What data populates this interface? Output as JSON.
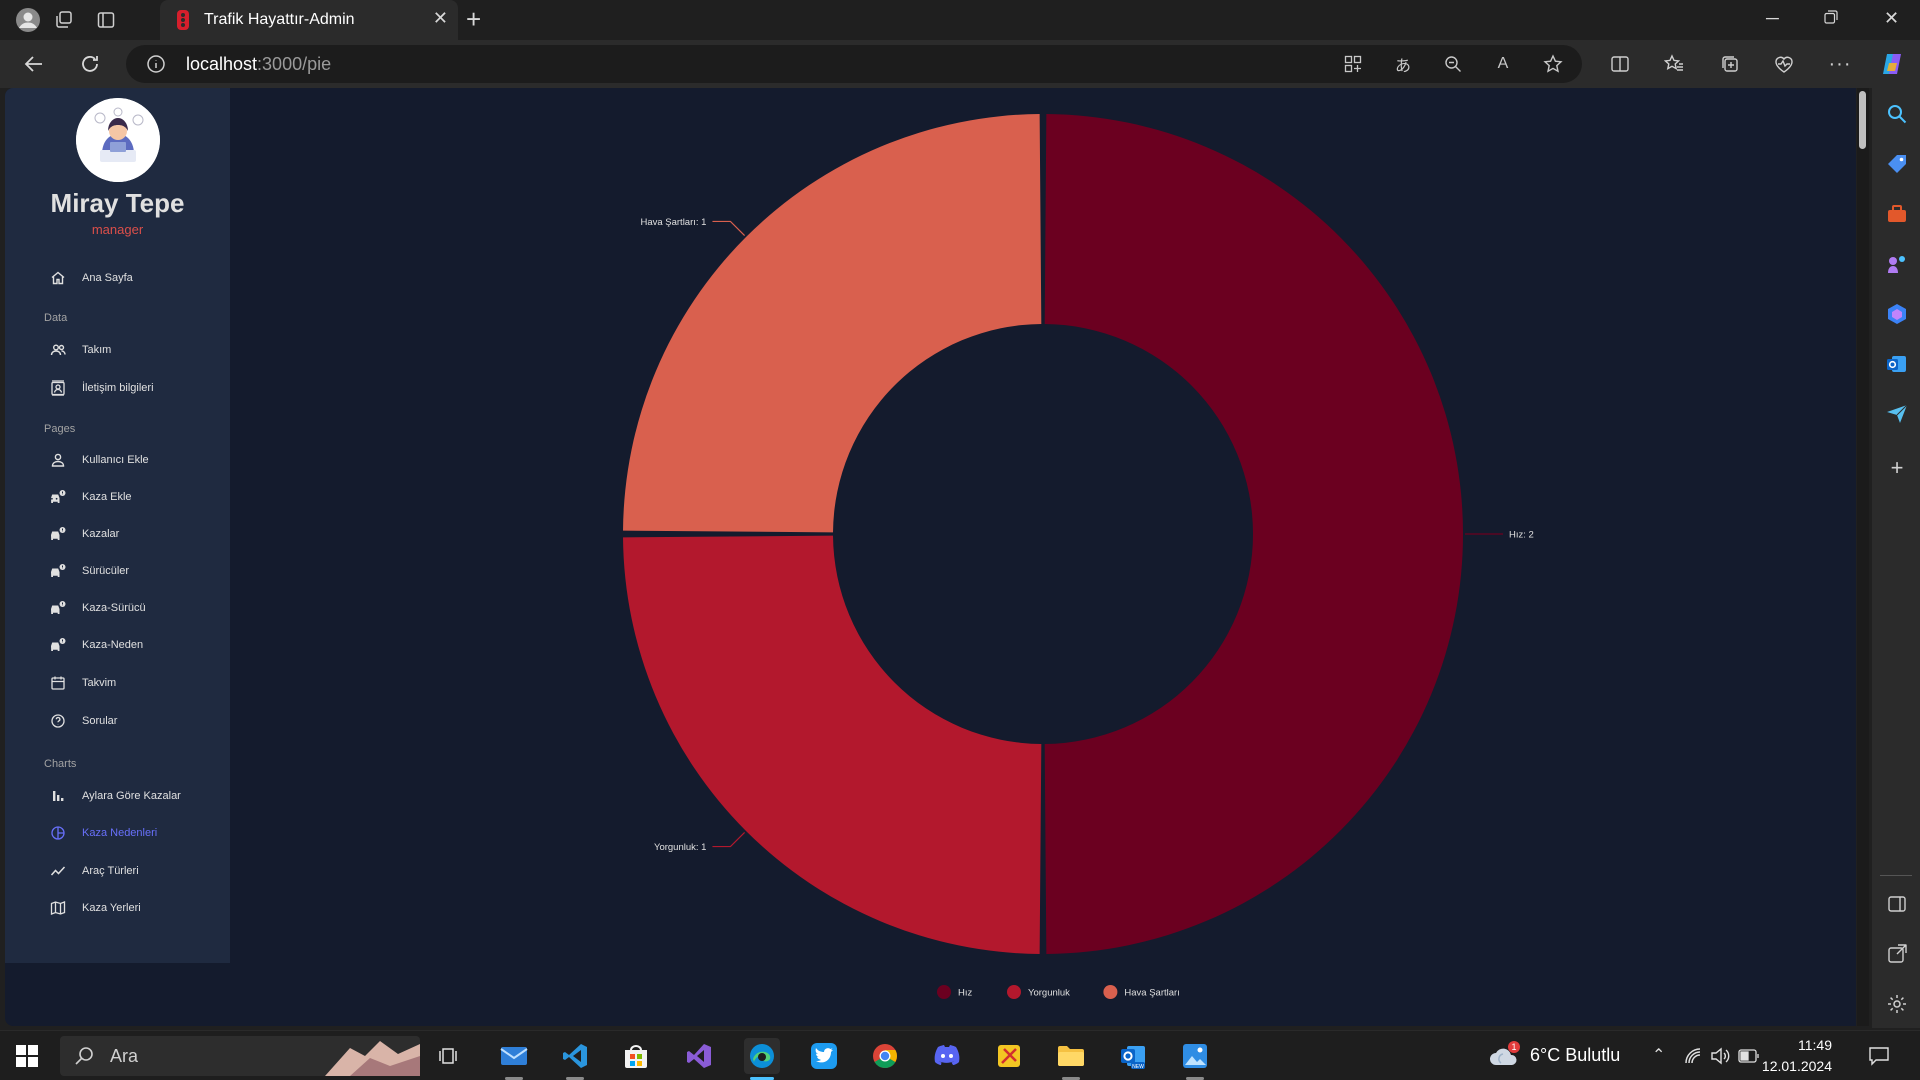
{
  "browser": {
    "tab_title": "Trafik Hayattır-Admin",
    "url_host": "localhost",
    "url_path": ":3000/pie"
  },
  "sidebar": {
    "user_name": "Miray Tepe",
    "user_role": "manager",
    "items": [
      {
        "label": "Ana Sayfa",
        "icon": "home-icon"
      },
      {
        "label": "Takım",
        "icon": "people-icon"
      },
      {
        "label": "İletişim bilgileri",
        "icon": "contacts-icon"
      },
      {
        "label": "Kullanıcı Ekle",
        "icon": "person-icon"
      },
      {
        "label": "Kaza Ekle",
        "icon": "car-crash-icon"
      },
      {
        "label": "Kazalar",
        "icon": "car-crash-icon"
      },
      {
        "label": "Sürücüler",
        "icon": "car-crash-icon"
      },
      {
        "label": "Kaza-Sürücü",
        "icon": "car-crash-icon"
      },
      {
        "label": "Kaza-Neden",
        "icon": "car-crash-icon"
      },
      {
        "label": "Takvim",
        "icon": "calendar-icon"
      },
      {
        "label": "Sorular",
        "icon": "help-icon"
      },
      {
        "label": "Aylara Göre Kazalar",
        "icon": "bar-chart-icon"
      },
      {
        "label": "Kaza Nedenleri",
        "icon": "pie-chart-icon"
      },
      {
        "label": "Araç Türleri",
        "icon": "line-chart-icon"
      },
      {
        "label": "Kaza Yerleri",
        "icon": "map-icon"
      }
    ],
    "sections": [
      "Data",
      "Pages",
      "Charts"
    ],
    "active_item": "Kaza Nedenleri"
  },
  "chart_data": {
    "type": "pie",
    "inner_radius_ratio": 0.5,
    "start": "top, clockwise",
    "categories": [
      "Hız",
      "Yorgunluk",
      "Hava Şartları"
    ],
    "values": [
      2,
      1,
      1
    ],
    "colors": [
      "#6b0020",
      "#b3182d",
      "#d9604e"
    ],
    "arc_labels": [
      "Hız: 2",
      "Yorgunluk: 1",
      "Hava Şartları: 1"
    ],
    "legend_position": "bottom"
  },
  "colors": {
    "page_bg": "#141b2d",
    "sidebar_bg": "#1f2a40",
    "accent": "#6870fa",
    "role_color": "#db4f4a"
  },
  "taskbar": {
    "search_placeholder": "Ara",
    "weather": "6°C  Bulutlu",
    "time": "11:49",
    "date": "12.01.2024",
    "weather_badge": "1"
  }
}
